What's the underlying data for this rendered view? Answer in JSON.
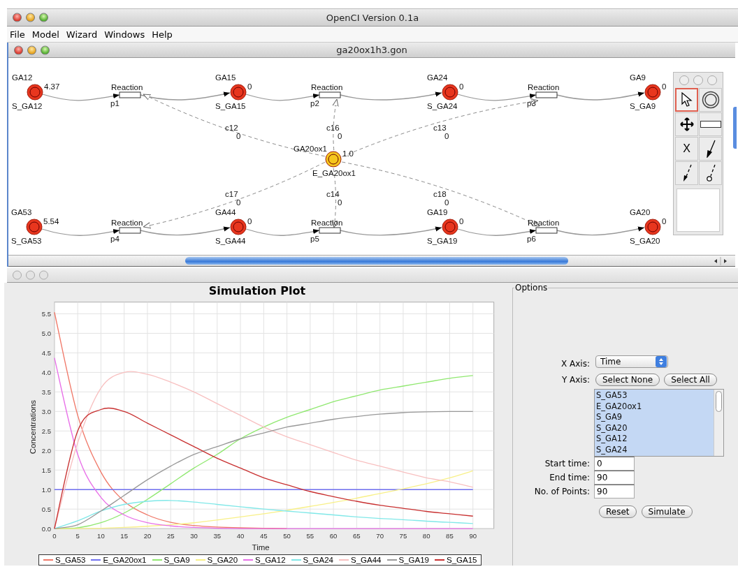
{
  "window": {
    "title": "OpenCI Version 0.1a"
  },
  "menu": [
    "File",
    "Model",
    "Wizard",
    "Windows",
    "Help"
  ],
  "document": {
    "title": "ga20ox1h3.gon",
    "species": [
      {
        "name": "GA12",
        "value": "4.37",
        "species_id": "S_GA12",
        "kind": "substrate"
      },
      {
        "name": "GA15",
        "value": "0",
        "species_id": "S_GA15",
        "kind": "substrate"
      },
      {
        "name": "GA24",
        "value": "0",
        "species_id": "S_GA24",
        "kind": "substrate"
      },
      {
        "name": "GA9",
        "value": "0",
        "species_id": "S_GA9",
        "kind": "substrate"
      },
      {
        "name": "GA20ox1",
        "value": "1.0",
        "species_id": "E_GA20ox1",
        "kind": "enzyme"
      },
      {
        "name": "GA53",
        "value": "5.54",
        "species_id": "S_GA53",
        "kind": "substrate"
      },
      {
        "name": "GA44",
        "value": "0",
        "species_id": "S_GA44",
        "kind": "substrate"
      },
      {
        "name": "GA19",
        "value": "0",
        "species_id": "S_GA19",
        "kind": "substrate"
      },
      {
        "name": "GA20",
        "value": "0",
        "species_id": "S_GA20",
        "kind": "substrate"
      }
    ],
    "reactions": [
      {
        "label": "Reaction",
        "name": "p1"
      },
      {
        "label": "Reaction",
        "name": "p2"
      },
      {
        "label": "Reaction",
        "name": "p3"
      },
      {
        "label": "Reaction",
        "name": "p4"
      },
      {
        "label": "Reaction",
        "name": "p5"
      },
      {
        "label": "Reaction",
        "name": "p6"
      }
    ],
    "controls": [
      {
        "name": "c12",
        "weight": "0"
      },
      {
        "name": "c16",
        "weight": "0"
      },
      {
        "name": "c13",
        "weight": "0"
      },
      {
        "name": "c17",
        "weight": "0"
      },
      {
        "name": "c14",
        "weight": "0"
      },
      {
        "name": "c18",
        "weight": "0"
      }
    ],
    "tools": [
      {
        "kind": "pointer",
        "selected": true
      },
      {
        "kind": "place",
        "selected": false
      },
      {
        "kind": "move",
        "selected": false
      },
      {
        "kind": "transition",
        "selected": false
      },
      {
        "kind": "delete",
        "label": "X",
        "selected": false
      },
      {
        "kind": "arc",
        "selected": false
      },
      {
        "kind": "test-arc",
        "selected": false
      },
      {
        "kind": "inhibitor-arc",
        "selected": false
      }
    ]
  },
  "plot": {
    "chart_data": {
      "type": "line",
      "title": "Simulation Plot",
      "xlabel": "Time",
      "ylabel": "Concentrations",
      "x": [
        0,
        5,
        10,
        15,
        20,
        25,
        30,
        35,
        40,
        45,
        50,
        55,
        60,
        65,
        70,
        75,
        80,
        85,
        90
      ],
      "grid": true,
      "xlim": [
        0,
        94.5
      ],
      "ylim": [
        0,
        5.8
      ],
      "xticks": [
        0,
        5,
        10,
        15,
        20,
        25,
        30,
        35,
        40,
        45,
        50,
        55,
        60,
        65,
        70,
        75,
        80,
        85,
        90
      ],
      "yticks": [
        {
          "value": 0,
          "label": "0.0"
        },
        {
          "value": 0.5,
          "label": "0.5"
        },
        {
          "value": 1,
          "label": "1.0"
        },
        {
          "value": 1.5,
          "label": "1.5"
        },
        {
          "value": 2,
          "label": "2.0"
        },
        {
          "value": 2.5,
          "label": "2.5"
        },
        {
          "value": 3,
          "label": "3.0"
        },
        {
          "value": 3.5,
          "label": "3.5"
        },
        {
          "value": 4,
          "label": "4.0"
        },
        {
          "value": 4.5,
          "label": "4.5"
        },
        {
          "value": 5,
          "label": "5.0"
        },
        {
          "value": 5.5,
          "label": "5.5"
        }
      ],
      "series": [
        {
          "name": "S_GA53",
          "color": "#f07868",
          "values": [
            5.54,
            2.9,
            1.45,
            0.7,
            0.35,
            0.16,
            0.08,
            0.04,
            0.02,
            0.01,
            0,
            null,
            null,
            null,
            null,
            null,
            null,
            null,
            null
          ]
        },
        {
          "name": "E_GA20ox1",
          "color": "#7070f0",
          "values": [
            1,
            1,
            1,
            1,
            1,
            1,
            1,
            1,
            1,
            1,
            1,
            1,
            1,
            1,
            1,
            1,
            1,
            1,
            1
          ]
        },
        {
          "name": "S_GA9",
          "color": "#90e870",
          "values": [
            0,
            0.02,
            0.15,
            0.4,
            0.75,
            1.15,
            1.55,
            1.9,
            2.3,
            2.6,
            2.85,
            3.05,
            3.25,
            3.4,
            3.55,
            3.65,
            3.75,
            3.85,
            3.92
          ]
        },
        {
          "name": "S_GA20",
          "color": "#f8f088",
          "values": [
            0,
            0,
            0.01,
            0.03,
            0.06,
            0.1,
            0.15,
            0.22,
            0.3,
            0.38,
            0.47,
            0.57,
            0.67,
            0.78,
            0.9,
            1.02,
            1.15,
            1.3,
            1.48
          ]
        },
        {
          "name": "S_GA12",
          "color": "#e870e8",
          "values": [
            4.37,
            1.9,
            0.8,
            0.35,
            0.15,
            0.07,
            0.03,
            0.01,
            0,
            0,
            0,
            0,
            0,
            0,
            0,
            0,
            0,
            0,
            0
          ]
        },
        {
          "name": "S_GA24",
          "color": "#80e8e8",
          "values": [
            0,
            0.2,
            0.45,
            0.62,
            0.7,
            0.72,
            0.68,
            0.62,
            0.56,
            0.5,
            0.45,
            0.4,
            0.35,
            0.3,
            0.26,
            0.23,
            0.19,
            0.16,
            0.13
          ]
        },
        {
          "name": "S_GA44",
          "color": "#f8c0c0",
          "values": [
            0,
            2.2,
            3.6,
            4.0,
            3.95,
            3.75,
            3.5,
            3.2,
            2.9,
            2.6,
            2.35,
            2.15,
            1.95,
            1.75,
            1.6,
            1.45,
            1.3,
            1.2,
            1.06
          ]
        },
        {
          "name": "S_GA19",
          "color": "#999999",
          "values": [
            0,
            0.1,
            0.45,
            0.85,
            1.25,
            1.6,
            1.9,
            2.1,
            2.3,
            2.45,
            2.6,
            2.7,
            2.8,
            2.87,
            2.93,
            2.97,
            2.99,
            3.0,
            3.0
          ]
        },
        {
          "name": "S_GA15",
          "color": "#c83030",
          "values": [
            0,
            2.5,
            3.05,
            3.0,
            2.7,
            2.4,
            2.1,
            1.8,
            1.55,
            1.3,
            1.12,
            0.95,
            0.82,
            0.7,
            0.6,
            0.52,
            0.44,
            0.38,
            0.32
          ]
        }
      ]
    }
  },
  "options": {
    "title": "Options",
    "x_axis": {
      "label": "X Axis:",
      "value": "Time"
    },
    "y_axis": {
      "label": "Y Axis:",
      "buttons": [
        "Select None",
        "Select All"
      ],
      "items": [
        {
          "name": "S_GA53",
          "selected": true
        },
        {
          "name": "E_GA20ox1",
          "selected": true
        },
        {
          "name": "S_GA9",
          "selected": true
        },
        {
          "name": "S_GA20",
          "selected": true
        },
        {
          "name": "S_GA12",
          "selected": true
        },
        {
          "name": "S_GA24",
          "selected": true
        }
      ]
    },
    "fields": [
      {
        "label": "Start time:",
        "value": "0"
      },
      {
        "label": "End time:",
        "value": "90"
      },
      {
        "label": "No. of Points:",
        "value": "90"
      }
    ],
    "buttons": [
      "Reset",
      "Simulate"
    ]
  }
}
